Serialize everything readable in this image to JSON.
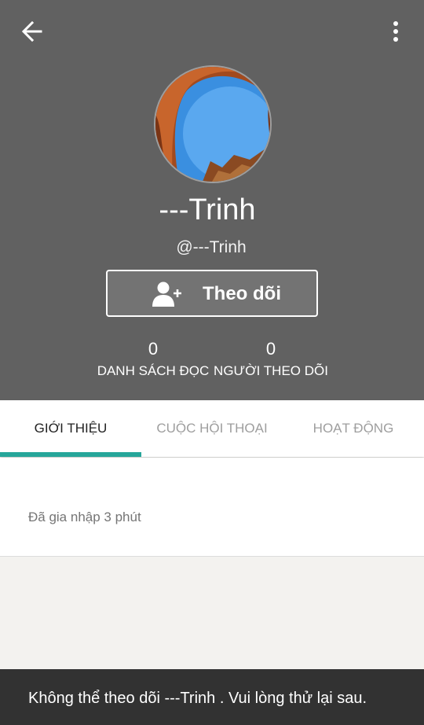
{
  "profile": {
    "display_name": "---Trinh",
    "username": "@---Trinh",
    "follow_label": "Theo dõi"
  },
  "stats": [
    {
      "value": "0",
      "label": "DANH SÁCH ĐỌC"
    },
    {
      "value": "0",
      "label": "NGƯỜI THEO DÕI"
    }
  ],
  "tabs": [
    {
      "label": "GIỚI THIỆU",
      "active": true
    },
    {
      "label": "CUỘC HỘI THOẠI",
      "active": false
    },
    {
      "label": "HOẠT ĐỘNG",
      "active": false
    }
  ],
  "about": {
    "joined_text": "Đã gia nhập 3 phút"
  },
  "snackbar": {
    "message": "Không thể theo dõi ---Trinh . Vui lòng thử lại sau."
  },
  "colors": {
    "header_bg": "#616161",
    "accent": "#26a69a",
    "snackbar_bg": "#323232"
  },
  "icons": [
    "back-arrow-icon",
    "more-vertical-icon",
    "add-user-icon"
  ]
}
